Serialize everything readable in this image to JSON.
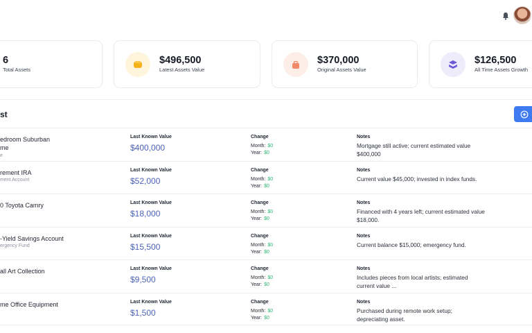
{
  "header": {
    "bell_icon": "bell-icon",
    "avatar": "user-avatar"
  },
  "stats": [
    {
      "value": "6",
      "label": "Total Assets",
      "icon": "",
      "color": ""
    },
    {
      "value": "$496,500",
      "label": "Latest Assets Value",
      "icon": "coins-icon",
      "color": "#f6b21a"
    },
    {
      "value": "$370,000",
      "label": "Original Assets Value",
      "icon": "bag-icon",
      "color": "#f08a6b"
    },
    {
      "value": "$126,500",
      "label": "All Time Assets Growth",
      "icon": "stack-icon",
      "color": "#6c58d8"
    }
  ],
  "section": {
    "title": "st",
    "add_icon": "plus-circle-icon"
  },
  "labels": {
    "last_known_value": "Last Known Value",
    "change": "Change",
    "month": "Month:",
    "year": "Year:",
    "notes": "Notes"
  },
  "assets": [
    {
      "name": "edroom Suburban",
      "name2": "me",
      "sub": "e",
      "value": "$400,000",
      "month": "$0",
      "year": "$0",
      "notes": "Mortgage still active; current estimated value $400,000"
    },
    {
      "name": "rement IRA",
      "name2": "",
      "sub": "ment Account",
      "value": "$52,000",
      "month": "$0",
      "year": "$0",
      "notes": "Current value $45,000; invested in index funds."
    },
    {
      "name": "0 Toyota Camry",
      "name2": "",
      "sub": "",
      "value": "$18,000",
      "month": "$0",
      "year": "$0",
      "notes": "Financed with 4 years left; current estimated value $18,000."
    },
    {
      "name": "-Yield Savings Account",
      "name2": "",
      "sub": "ergency Fund",
      "value": "$15,500",
      "month": "$0",
      "year": "$0",
      "notes": "Current balance $15,000; emergency fund."
    },
    {
      "name": "all Art Collection",
      "name2": "",
      "sub": "",
      "value": "$9,500",
      "month": "$0",
      "year": "$0",
      "notes": "Includes pieces from local artists; estimated current value ..."
    },
    {
      "name": "me Office Equipment",
      "name2": "",
      "sub": "",
      "value": "$1,500",
      "month": "$0",
      "year": "$0",
      "notes": "Purchased during remote work setup; depreciating asset."
    }
  ]
}
